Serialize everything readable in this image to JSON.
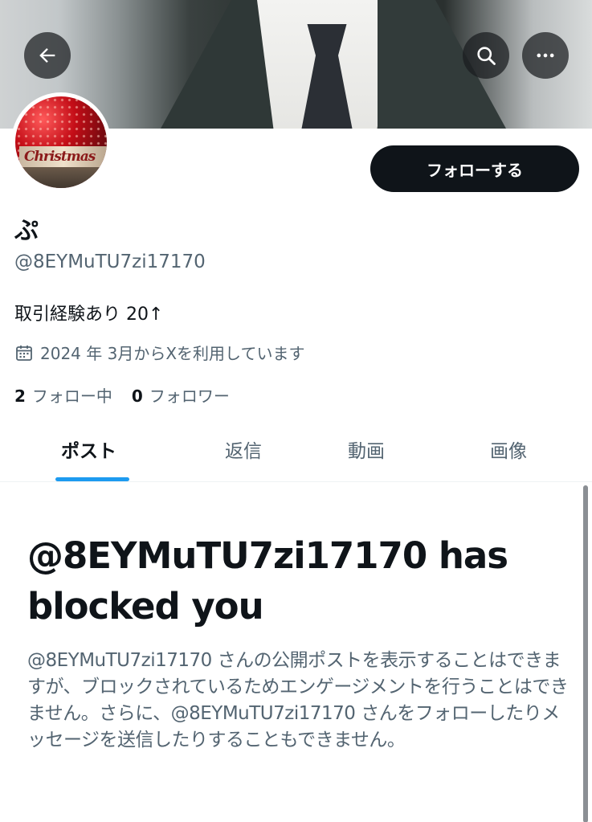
{
  "profile": {
    "display_name": "ぷ",
    "handle": "@8EYMuTU7zi17170",
    "bio": "取引経験あり 20↑",
    "joined": "2024 年 3月からXを利用しています",
    "following_count": "2",
    "following_label": "フォロー中",
    "followers_count": "0",
    "followers_label": "フォロワー",
    "avatar_sign_text": "Christmas"
  },
  "header": {
    "back_icon": "arrow-left-icon",
    "search_icon": "search-icon",
    "more_icon": "more-horizontal-icon"
  },
  "actions": {
    "follow_label": "フォローする"
  },
  "tabs": [
    {
      "label": "ポスト",
      "active": true
    },
    {
      "label": "返信",
      "active": false
    },
    {
      "label": "動画",
      "active": false
    },
    {
      "label": "画像",
      "active": false
    }
  ],
  "blocked": {
    "title": "@8EYMuTU7zi17170 has blocked you",
    "body": "@8EYMuTU7zi17170 さんの公開ポストを表示することはできますが、ブロックされているためエンゲージメントを行うことはできません。さらに、@8EYMuTU7zi17170 さんをフォローしたりメッセージを送信したりすることもできません。"
  },
  "colors": {
    "text_primary": "#0f1419",
    "text_secondary": "#536471",
    "accent": "#1d9bf0",
    "button_bg": "#0f1419"
  }
}
